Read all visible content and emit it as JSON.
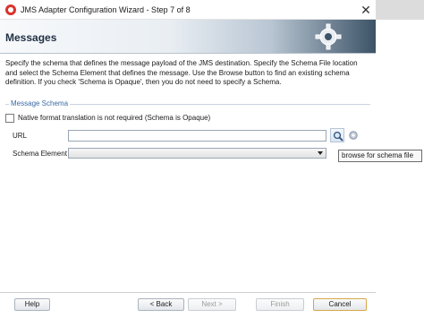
{
  "window": {
    "title": "JMS Adapter Configuration Wizard - Step 7 of 8",
    "close_glyph": "✕"
  },
  "banner": {
    "title": "Messages"
  },
  "description": "Specify the schema that defines the message payload of the JMS destination.  Specify the Schema File location and select the Schema Element that defines the message. Use the Browse button to find an existing schema definition. If you check 'Schema is Opaque', then you do not need to specify a Schema.",
  "schema_group": {
    "legend": "Message Schema",
    "native_checkbox": {
      "label": "Native format translation is not required (Schema is Opaque)",
      "checked": false
    },
    "url": {
      "label": "URL",
      "value": ""
    },
    "schema_element": {
      "label": "Schema Element",
      "value": ""
    },
    "browse_tooltip": "browse for schema file"
  },
  "footer": {
    "help": "Help",
    "back": "< Back",
    "next": "Next >",
    "finish": "Finish",
    "cancel": "Cancel"
  },
  "colors": {
    "accent": "#3a6aa5",
    "banner_dark": "#3c5367",
    "primary_border": "#d6a64a"
  }
}
